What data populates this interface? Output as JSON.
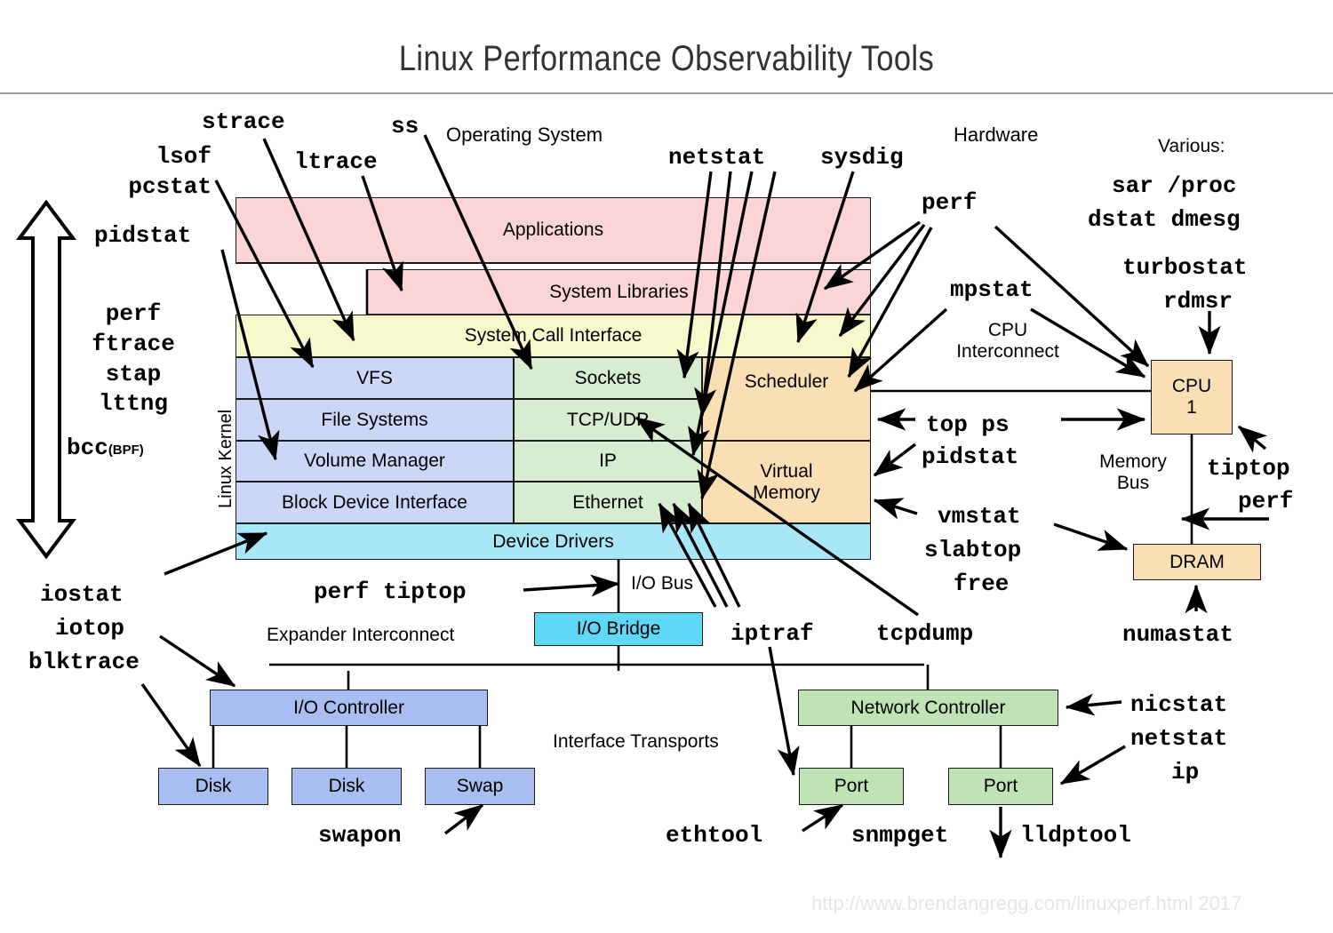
{
  "page": {
    "title": "Linux Performance Observability Tools",
    "footer": "http://www.brendangregg.com/linuxperf.html 2017"
  },
  "section_labels": {
    "operating_system": "Operating System",
    "hardware": "Hardware",
    "various": "Various:",
    "linux_kernel": "Linux Kernel",
    "cpu_interconnect": "CPU\nInterconnect",
    "memory_bus": "Memory\nBus",
    "io_bus": "I/O Bus",
    "expander_interconnect": "Expander Interconnect",
    "interface_transports": "Interface Transports"
  },
  "stack": {
    "applications": "Applications",
    "system_libraries": "System Libraries",
    "system_call_interface": "System Call Interface",
    "vfs": "VFS",
    "file_systems": "File Systems",
    "volume_manager": "Volume Manager",
    "block_device_interface": "Block Device Interface",
    "sockets": "Sockets",
    "tcp_udp": "TCP/UDP",
    "ip": "IP",
    "ethernet": "Ethernet",
    "scheduler": "Scheduler",
    "virtual_memory": "Virtual\nMemory",
    "device_drivers": "Device Drivers"
  },
  "hardware": {
    "cpu": "CPU\n1",
    "dram": "DRAM",
    "io_bridge": "I/O Bridge",
    "io_controller": "I/O Controller",
    "disk1": "Disk",
    "disk2": "Disk",
    "swap": "Swap",
    "network_controller": "Network Controller",
    "port1": "Port",
    "port2": "Port"
  },
  "tools": {
    "lsof_pcstat": "lsof\npcstat",
    "strace": "strace",
    "ltrace": "ltrace",
    "ss": "ss",
    "netstat_top": "netstat",
    "sysdig": "sysdig",
    "pidstat_top": "pidstat",
    "perf_hw": "perf",
    "mpstat": "mpstat",
    "sar_proc": "sar /proc",
    "dstat_dmesg": "dstat dmesg",
    "turbostat": "turbostat",
    "rdmsr": "rdmsr",
    "kernel_tracers": "perf\nftrace\nstap\nlttng",
    "bcc": "bcc",
    "bcc_suffix": "(BPF)",
    "top_ps": "top ps",
    "pidstat_cpu": "pidstat",
    "tiptop": "tiptop",
    "perf_mem": "perf",
    "vmstat": "vmstat",
    "slabtop": "slabtop",
    "free": "free",
    "numastat": "numastat",
    "iostat": "iostat",
    "iotop": "iotop",
    "blktrace": "blktrace",
    "perf_tiptop": "perf tiptop",
    "iptraf": "iptraf",
    "tcpdump": "tcpdump",
    "swapon": "swapon",
    "ethtool": "ethtool",
    "snmpget": "snmpget",
    "lldptool": "lldptool",
    "nicstat": "nicstat",
    "netstat_nic": "netstat",
    "ip": "ip"
  },
  "colors": {
    "pink": "#fbd5d5",
    "yellow": "#f8f8cd",
    "blue": "#ccd6f6",
    "green": "#d7ecd0",
    "orange": "#fbdfb4",
    "cyan": "#a8e7f8",
    "io_blue": "#a8bdf0",
    "net_green": "#bfe3b4",
    "bridge_cyan": "#5fd8f7",
    "stroke": "#1b1b1b"
  }
}
